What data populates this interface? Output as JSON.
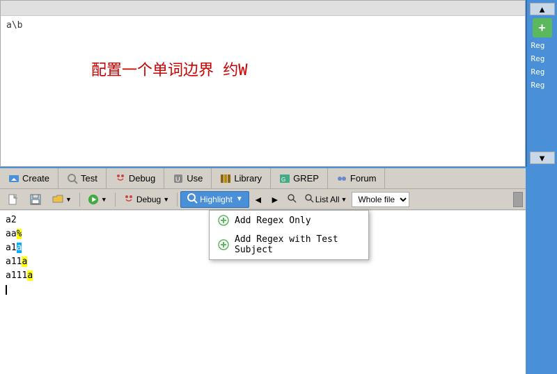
{
  "editor": {
    "title": "",
    "regex_text": "a\\b",
    "chinese_text": "配置一个单词边界  约W"
  },
  "tabs": [
    {
      "id": "create",
      "label": "Create",
      "icon": "⬇"
    },
    {
      "id": "test",
      "label": "Test",
      "icon": "🔍"
    },
    {
      "id": "debug",
      "label": "Debug",
      "icon": "🐛"
    },
    {
      "id": "use",
      "label": "Use",
      "icon": "⚙"
    },
    {
      "id": "library",
      "label": "Library",
      "icon": "📚"
    },
    {
      "id": "grep",
      "label": "GREP",
      "icon": "📋"
    },
    {
      "id": "forum",
      "label": "Forum",
      "icon": "👥"
    }
  ],
  "toolbar": {
    "highlight_label": "Highlight",
    "list_all_label": "List All▼",
    "whole_file_label": "Whole file",
    "dropdown_items": [
      {
        "id": "add-regex-only",
        "label": "Add Regex Only"
      },
      {
        "id": "add-regex-with-subject",
        "label": "Add Regex with Test Subject"
      }
    ]
  },
  "text_lines": [
    {
      "id": 1,
      "content": "a2",
      "highlighted": false
    },
    {
      "id": 2,
      "content": "aa%",
      "highlighted": "yellow"
    },
    {
      "id": 3,
      "content": "a1a",
      "highlighted": "blue"
    },
    {
      "id": 4,
      "content": "a11a",
      "highlighted": "yellow"
    },
    {
      "id": 5,
      "content": "a111a",
      "highlighted": "yellow"
    }
  ],
  "sidebar": {
    "add_label": "+",
    "regex_labels": [
      "Reg",
      "Reg",
      "Reg",
      "Reg"
    ]
  },
  "icons": {
    "scroll_up": "▲",
    "scroll_down": "▼",
    "magnify_plus": "🔍",
    "magnify_minus": "🔍",
    "arrow_left": "◄",
    "arrow_right": "►",
    "chevron_down": "▼",
    "plus": "+"
  }
}
